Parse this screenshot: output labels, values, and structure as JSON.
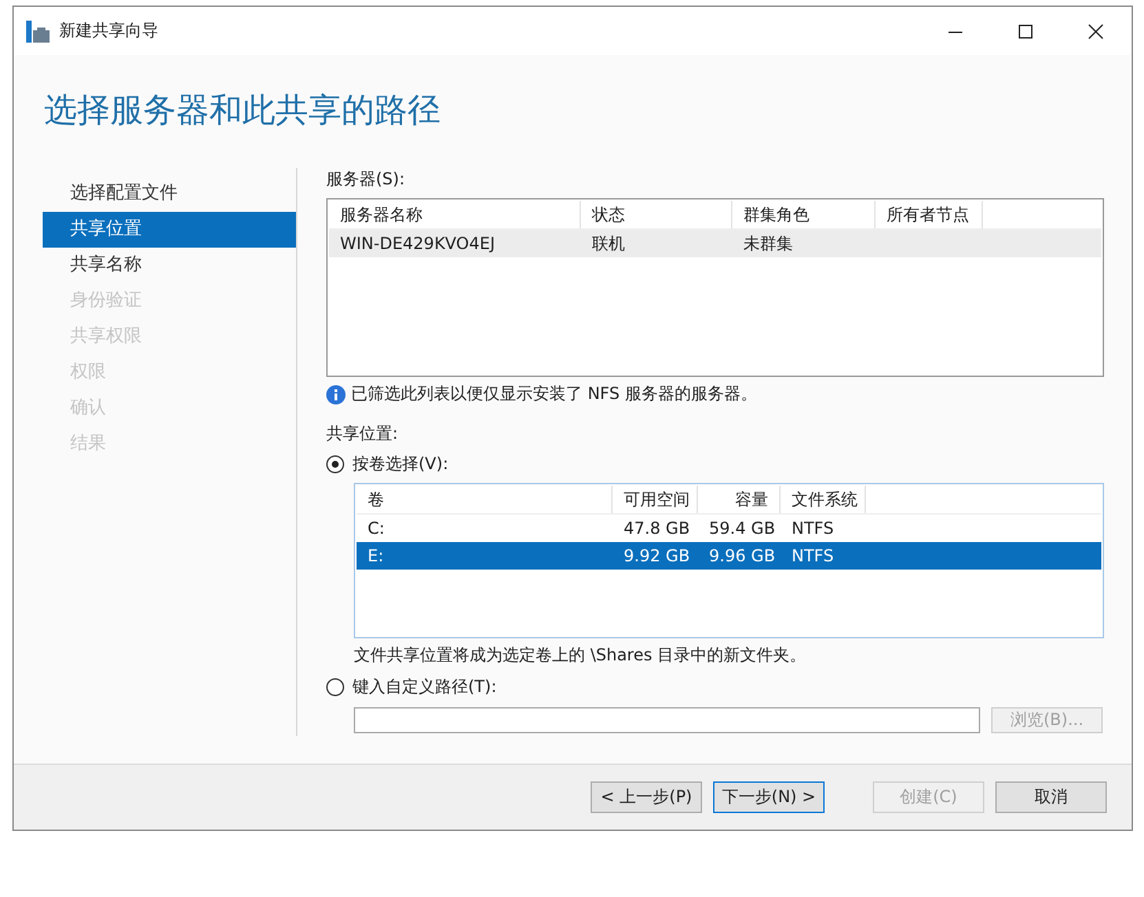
{
  "window": {
    "title": "新建共享向导"
  },
  "heading": "选择服务器和此共享的路径",
  "sidebar": {
    "items": [
      {
        "label": "选择配置文件",
        "selected": false,
        "disabled": false
      },
      {
        "label": "共享位置",
        "selected": true,
        "disabled": false
      },
      {
        "label": "共享名称",
        "selected": false,
        "disabled": false
      },
      {
        "label": "身份验证",
        "selected": false,
        "disabled": true
      },
      {
        "label": "共享权限",
        "selected": false,
        "disabled": true
      },
      {
        "label": "权限",
        "selected": false,
        "disabled": true
      },
      {
        "label": "确认",
        "selected": false,
        "disabled": true
      },
      {
        "label": "结果",
        "selected": false,
        "disabled": true
      }
    ]
  },
  "servers": {
    "label": "服务器(S):",
    "columns": [
      "服务器名称",
      "状态",
      "群集角色",
      "所有者节点"
    ],
    "rows": [
      {
        "cells": [
          "WIN-DE429KVO4EJ",
          "联机",
          "未群集",
          ""
        ],
        "selected": true
      }
    ]
  },
  "info": "已筛选此列表以便仅显示安装了 NFS 服务器的服务器。",
  "location": {
    "label": "共享位置:",
    "by_volume": {
      "label": "按卷选择(V):",
      "selected": true
    },
    "volumes": {
      "columns": [
        "卷",
        "可用空间",
        "容量",
        "文件系统"
      ],
      "rows": [
        {
          "cells": [
            "C:",
            "47.8 GB",
            "59.4 GB",
            "NTFS"
          ],
          "selected": false
        },
        {
          "cells": [
            "E:",
            "9.92 GB",
            "9.96 GB",
            "NTFS"
          ],
          "selected": true
        }
      ]
    },
    "note": "文件共享位置将成为选定卷上的 \\Shares 目录中的新文件夹。",
    "custom": {
      "label": "键入自定义路径(T):",
      "selected": false
    },
    "browse": {
      "label": "浏览(B)...",
      "disabled": true
    }
  },
  "buttons": [
    {
      "label": "< 上一步(P)",
      "default": false,
      "disabled": false
    },
    {
      "label": "下一步(N) >",
      "default": true,
      "disabled": false
    },
    {
      "label": "创建(C)",
      "default": false,
      "disabled": true
    },
    {
      "label": "取消",
      "default": false,
      "disabled": false
    }
  ]
}
